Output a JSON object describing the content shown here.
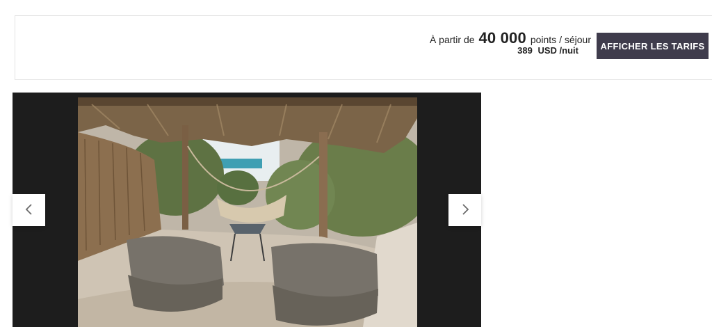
{
  "rate": {
    "prefix": "À partir de",
    "points_value": "40 000",
    "points_suffix": "points / séjour",
    "cash_amount": "389",
    "cash_currency": "USD /nuit",
    "cta_label": "AFFICHER LES TARIFS"
  },
  "gallery": {
    "prev_icon": "chevron-left-icon",
    "next_icon": "chevron-right-icon"
  },
  "colors": {
    "cta_background": "#3f3c4c",
    "gallery_background": "#1d1d1d"
  }
}
